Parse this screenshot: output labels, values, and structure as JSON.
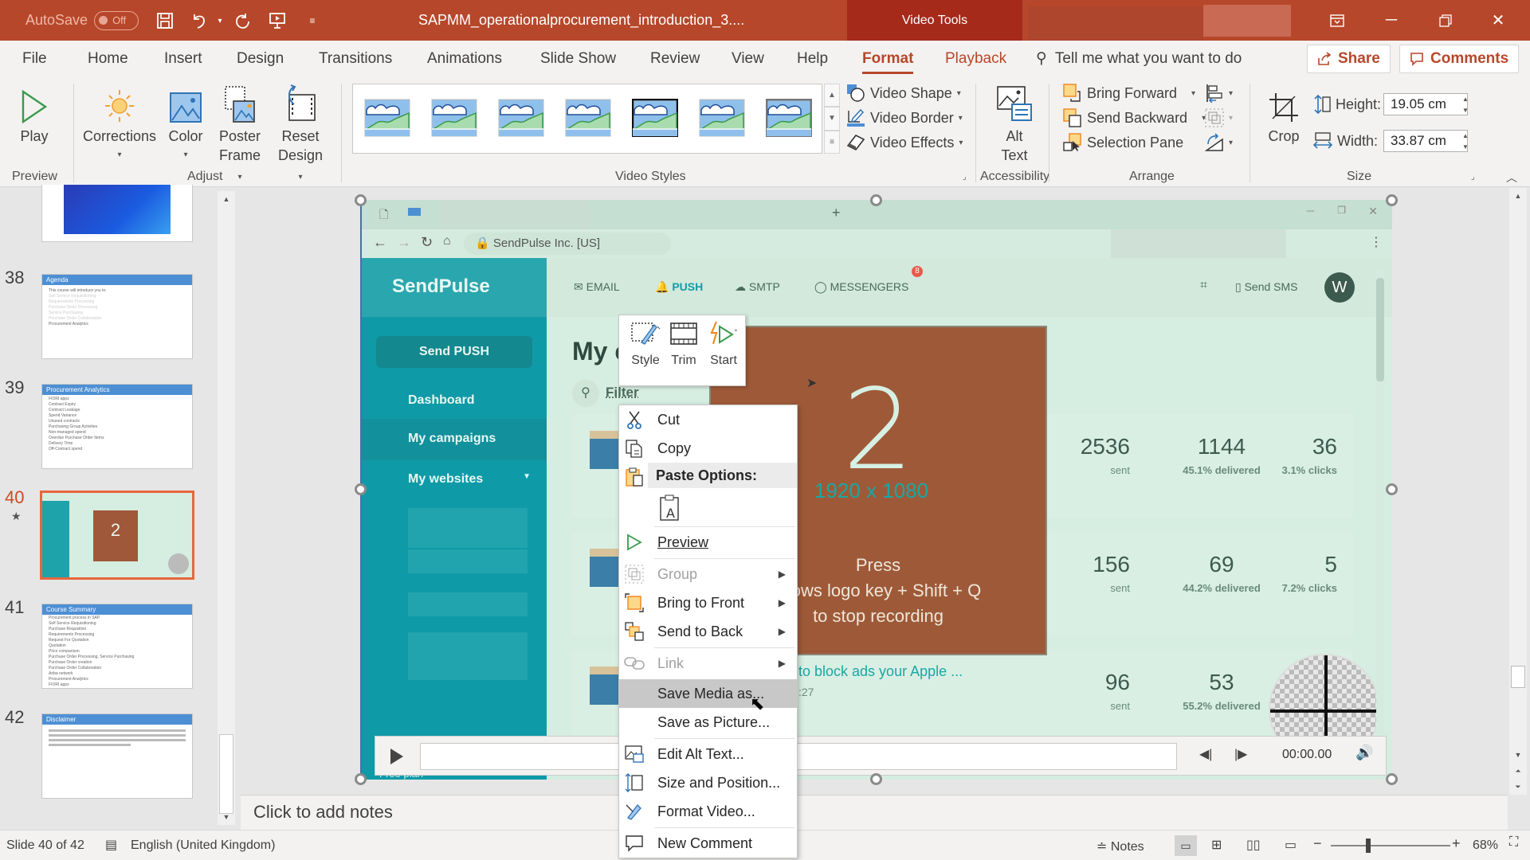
{
  "titlebar": {
    "autosave_label": "AutoSave",
    "autosave_state": "Off",
    "doc_title": "SAPMM_operationalprocurement_introduction_3....",
    "context_tool": "Video Tools"
  },
  "tabs": {
    "items": [
      "File",
      "Home",
      "Insert",
      "Design",
      "Transitions",
      "Animations",
      "Slide Show",
      "Review",
      "View",
      "Help",
      "Format",
      "Playback"
    ],
    "active": "Format",
    "tell_me": "Tell me what you want to do",
    "share": "Share",
    "comments": "Comments"
  },
  "ribbon": {
    "preview": {
      "label": "Preview",
      "play": "Play"
    },
    "adjust": {
      "label": "Adjust",
      "corrections": "Corrections",
      "color": "Color",
      "poster_frame_1": "Poster",
      "poster_frame_2": "Frame",
      "reset_design_1": "Reset",
      "reset_design_2": "Design"
    },
    "video_styles": {
      "label": "Video Styles",
      "video_shape": "Video Shape",
      "video_border": "Video Border",
      "video_effects": "Video Effects"
    },
    "accessibility": {
      "label": "Accessibility",
      "alt_text_1": "Alt",
      "alt_text_2": "Text"
    },
    "arrange": {
      "label": "Arrange",
      "bring_forward": "Bring Forward",
      "send_backward": "Send Backward",
      "selection_pane": "Selection Pane"
    },
    "size": {
      "label": "Size",
      "crop": "Crop",
      "height_label": "Height:",
      "height_value": "19.05 cm",
      "width_label": "Width:",
      "width_value": "33.87 cm"
    }
  },
  "thumbnails": [
    {
      "num": "",
      "title": "",
      "lines": []
    },
    {
      "num": "38",
      "title": "Agenda",
      "lines": [
        "This course will introduce you to:",
        "Self Service Requisitioning",
        "Requirements Processing",
        "Purchase Order Processing",
        "Service Purchasing",
        "Purchase Order Collaboration",
        "Procurement Analytics"
      ]
    },
    {
      "num": "39",
      "title": "Procurement Analytics",
      "lines": [
        "FIORI apps",
        "Contract Expiry",
        "Contract Leakage",
        "Spend Variance",
        "Unused contracts",
        "Purchasing Group Activities",
        "Non-managed spend",
        "Overdue Purchase Order Items",
        "Delivery Time",
        "Off-Contract spend"
      ]
    },
    {
      "num": "40",
      "title": "",
      "lines": []
    },
    {
      "num": "41",
      "title": "Course Summary",
      "lines": [
        "Procurement process in SAP",
        "Self Service Requisitioning",
        "Purchase Requisition",
        "Requirements Processing",
        "Request For Quotation",
        "Quotation",
        "Price comparison",
        "Purchase Order Processing, Service Purchasing",
        "Purchase Order creation",
        "Purchase Order Collaboration",
        "Ariba network",
        "Procurement Analytics",
        "FIORI apps"
      ]
    },
    {
      "num": "42",
      "title": "Disclaimer",
      "lines": []
    }
  ],
  "video": {
    "address": "SendPulse Inc. [US]",
    "brand": "SendPulse",
    "nav": [
      "EMAIL",
      "PUSH",
      "SMTP",
      "MESSENGERS"
    ],
    "badge": "8",
    "send_sms": "Send SMS",
    "avatar": "W",
    "send_push": "Send PUSH",
    "sidebar": [
      "Dashboard",
      "My campaigns",
      "My websites"
    ],
    "free_plan": "Free plan",
    "page_title": "My c",
    "filter": "Filter",
    "countdown": "2",
    "resolution": "1920 x 1080",
    "press": "Press",
    "hint_line": "ows logo key + Shift + Q",
    "hint_line2": "to stop recording",
    "row3_title": "to block ads your Apple ...",
    "row3_date": ":27",
    "rows": [
      {
        "sent": "2536",
        "sent_label": "sent",
        "delivered": "1144",
        "delivered_label": "45.1% delivered",
        "clicks": "36",
        "clicks_label": "3.1% clicks"
      },
      {
        "sent": "156",
        "sent_label": "sent",
        "delivered": "69",
        "delivered_label": "44.2% delivered",
        "clicks": "5",
        "clicks_label": "7.2% clicks"
      },
      {
        "sent": "96",
        "sent_label": "sent",
        "delivered": "53",
        "delivered_label": "55.2% delivered",
        "clicks": "",
        "clicks_label": ""
      }
    ],
    "time": "00:00.00"
  },
  "minitoolbar": {
    "style": "Style",
    "trim": "Trim",
    "start": "Start"
  },
  "context_menu": {
    "cut": "Cut",
    "copy": "Copy",
    "paste_options": "Paste Options:",
    "preview": "Preview",
    "group": "Group",
    "bring_to_front": "Bring to Front",
    "send_to_back": "Send to Back",
    "link": "Link",
    "save_media_as": "Save Media as...",
    "save_as_picture": "Save as Picture...",
    "edit_alt_text": "Edit Alt Text...",
    "size_and_position": "Size and Position...",
    "format_video": "Format Video...",
    "new_comment": "New Comment"
  },
  "notes": {
    "placeholder": "Click to add notes"
  },
  "status": {
    "slide": "Slide 40 of 42",
    "language": "English (United Kingdom)",
    "notes": "Notes",
    "zoom": "68%"
  }
}
